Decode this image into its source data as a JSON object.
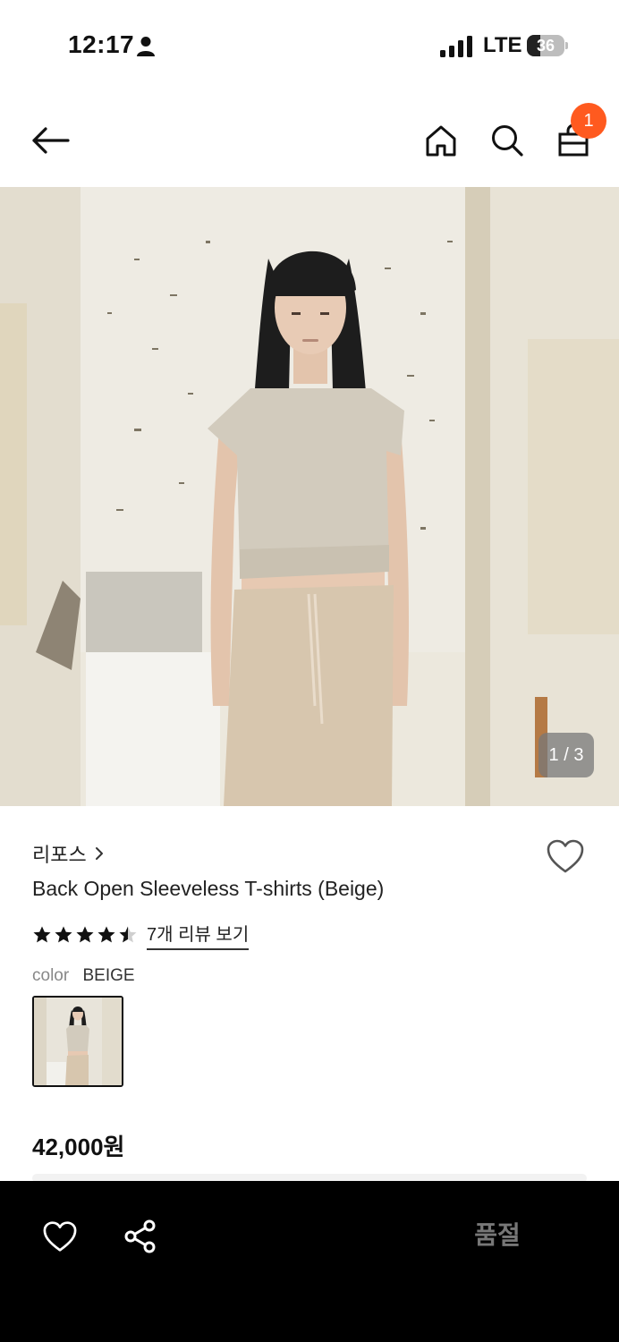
{
  "status_bar": {
    "time": "12:17",
    "network": "LTE",
    "battery_level": 36,
    "battery_text": "36",
    "icons": [
      "person-icon",
      "signal-icon",
      "battery-icon"
    ]
  },
  "nav": {
    "icons": [
      "back-arrow-icon",
      "home-icon",
      "search-icon",
      "shopping-bag-icon"
    ],
    "cart_count": "1",
    "badge_color": "#ff5a1f"
  },
  "gallery": {
    "current_page": 1,
    "total_pages": 3,
    "indicator": "1 / 3"
  },
  "product": {
    "brand": "리포스",
    "title": "Back Open Sleeveless T-shirts (Beige)",
    "rating": 4.5,
    "review_link": "7개 리뷰 보기",
    "color_label": "color",
    "color_value": "BEIGE",
    "price": "42,000원"
  },
  "bottom_bar": {
    "icons": [
      "heart-icon",
      "share-icon"
    ],
    "status": "품절",
    "background": "#000000"
  }
}
